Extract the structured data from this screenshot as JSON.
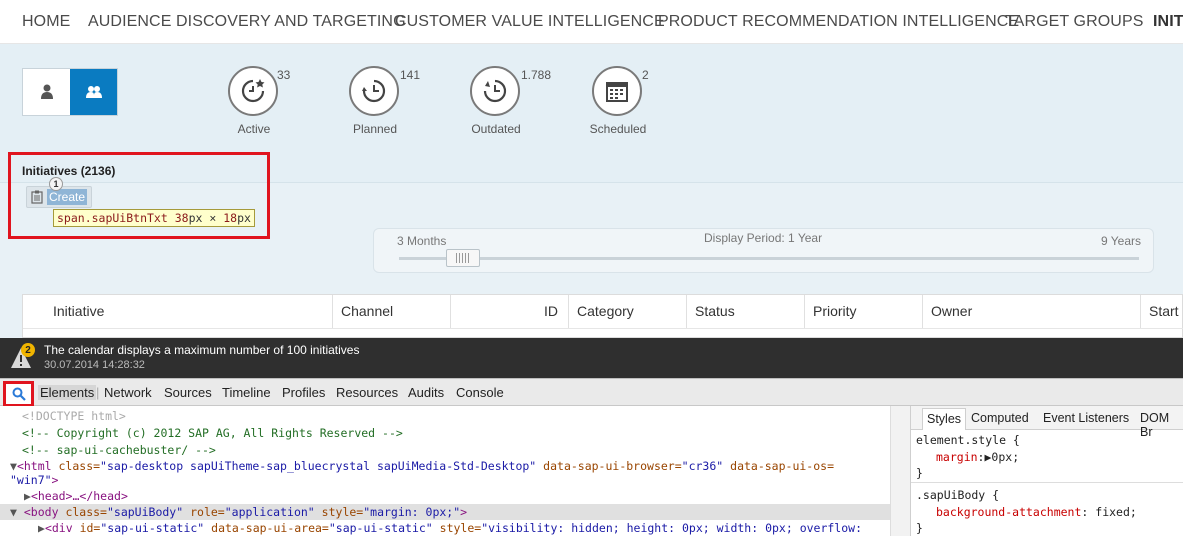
{
  "nav": {
    "items": [
      "HOME",
      "AUDIENCE DISCOVERY AND TARGETING",
      "CUSTOMER VALUE INTELLIGENCE",
      "PRODUCT RECOMMENDATION INTELLIGENCE",
      "TARGET GROUPS",
      "INITI"
    ]
  },
  "view_toggle": {
    "selected": "group"
  },
  "stats": [
    {
      "label": "Active",
      "count": "33",
      "icon": "clock-star-icon"
    },
    {
      "label": "Planned",
      "count": "141",
      "icon": "clock-icon"
    },
    {
      "label": "Outdated",
      "count": "1.788",
      "icon": "clock-back-icon"
    },
    {
      "label": "Scheduled",
      "count": "2",
      "icon": "calendar-icon"
    }
  ],
  "initiatives": {
    "title": "Initiatives (2136)",
    "create_label": "Create",
    "badge": "1"
  },
  "tooltip": {
    "selector": "span.sapUiBtnTxt",
    "width": "38",
    "height": "18",
    "unit": "px",
    "times": "×"
  },
  "slider": {
    "left_label": "3 Months",
    "center_label": "Display Period: 1 Year",
    "right_label": "9 Years"
  },
  "table": {
    "columns": [
      "Initiative",
      "Channel",
      "ID",
      "Category",
      "Status",
      "Priority",
      "Owner",
      "Start"
    ]
  },
  "notification": {
    "count": "2",
    "message": "The calendar displays a maximum number of 100 initiatives",
    "timestamp": "30.07.2014 14:28:32"
  },
  "devtools": {
    "tabs": [
      "Elements",
      "Network",
      "Sources",
      "Timeline",
      "Profiles",
      "Resources",
      "Audits",
      "Console"
    ],
    "selected_tab": "Elements",
    "code": {
      "doctype": "<!DOCTYPE html>",
      "comment1": "<!-- Copyright (c) 2012 SAP AG, All Rights Reserved -->",
      "comment2": "<!--  sap-ui-cachebuster/ -->",
      "html_open": "<html",
      "html_class_attr": "class=",
      "html_class_val": "\"sap-desktop  sapUiTheme-sap_bluecrystal sapUiMedia-Std-Desktop\"",
      "html_browser_attr": "data-sap-ui-browser=",
      "html_browser_val": "\"cr36\"",
      "html_os_attr": "data-sap-ui-os=",
      "html_os_val_line2": "\"win7\"",
      "head": "<head>…</head>",
      "body_open": "<body",
      "body_class_attr": "class=",
      "body_class_val": "\"sapUiBody\"",
      "body_role_attr": "role=",
      "body_role_val": "\"application\"",
      "body_style_attr": "style=",
      "body_style_val": "\"margin: 0px;\"",
      "div_open": "<div",
      "div_id_attr": "id=",
      "div_id_val": "\"sap-ui-static\"",
      "div_area_attr": "data-sap-ui-area=",
      "div_area_val": "\"sap-ui-static\"",
      "div_style_attr": "style=",
      "div_style_val": "\"visibility: hidden; height: 0px; width: 0px; overflow:"
    },
    "styles_tabs": [
      "Styles",
      "Computed",
      "Event Listeners",
      "DOM Br"
    ],
    "styles": {
      "rule1_selector": "element.style {",
      "rule1_prop": "margin",
      "rule1_value": "0px;",
      "rule_close": "}",
      "rule2_selector": ".sapUiBody {",
      "rule2_prop": "background-attachment",
      "rule2_value": "fixed;"
    }
  },
  "colors": {
    "accent": "#0a7bc1",
    "highlight_red": "#e0141e"
  }
}
